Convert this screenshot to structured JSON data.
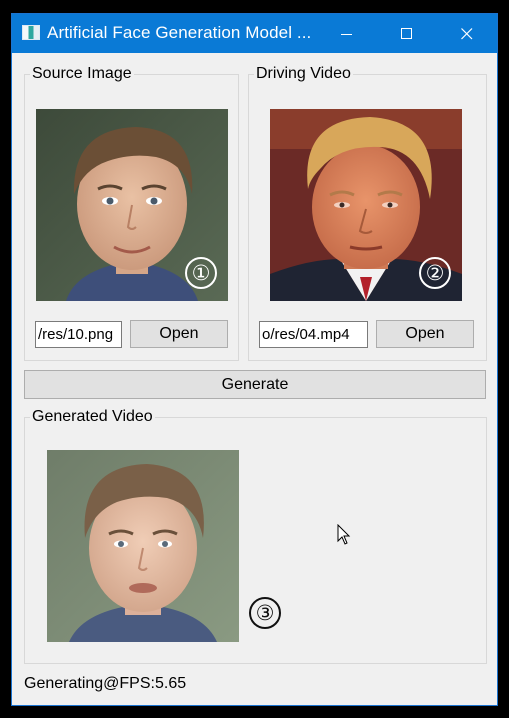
{
  "window": {
    "title": "Artificial Face Generation Model ...",
    "minimize_glyph": "minimize-icon",
    "maximize_glyph": "maximize-icon",
    "close_glyph": "close-icon",
    "titlebar_color": "#0a7ad6"
  },
  "source": {
    "group_title": "Source Image",
    "badge": "①",
    "path_value": "/res/10.png",
    "open_label": "Open"
  },
  "driving": {
    "group_title": "Driving Video",
    "badge": "②",
    "path_value": "o/res/04.mp4",
    "open_label": "Open"
  },
  "generate_label": "Generate",
  "generated": {
    "group_title": "Generated Video",
    "badge": "③"
  },
  "status_text": "Generating@FPS:5.65"
}
